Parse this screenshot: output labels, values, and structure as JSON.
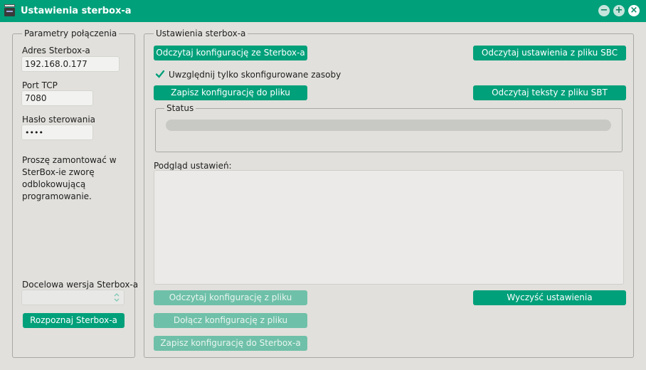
{
  "window": {
    "title": "Ustawienia sterbox-a",
    "minimize_glyph": "−",
    "maximize_glyph": "+",
    "close_glyph": "×"
  },
  "connection": {
    "group_title": "Parametry połączenia",
    "address_label": "Adres Sterbox-a",
    "address_value": "192.168.0.177",
    "port_label": "Port TCP",
    "port_value": "7080",
    "password_label": "Hasło sterowania",
    "password_value": "••••",
    "info_text": "Proszę zamontować w SterBox-ie zworę odblokowującą programowanie.",
    "target_version_label": "Docelowa wersja Sterbox-a",
    "target_version_value": "",
    "detect_button": "Rozpoznaj Sterbox-a"
  },
  "settings": {
    "group_title": "Ustawienia sterbox-a",
    "read_config_button": "Odczytaj konfigurację ze Sterbox-a",
    "read_sbc_button": "Odczytaj ustawienia z pliku SBC",
    "only_configured_label": "Uwzględnij tylko skonfigurowane zasoby",
    "only_configured_checked": true,
    "save_config_file_button": "Zapisz konfigurację do pliku",
    "read_sbt_button": "Odczytaj teksty z pliku SBT",
    "status_title": "Status",
    "status_progress": 0,
    "preview_label": "Podgląd ustawień:",
    "preview_text": "",
    "read_config_file_button": "Odczytaj konfigurację z pliku",
    "attach_config_file_button": "Dołącz konfigurację z pliku",
    "write_config_sterbox_button": "Zapisz konfigurację do Sterbox-a",
    "clear_settings_button": "Wyczyść ustawienia"
  },
  "colors": {
    "accent": "#00a07a",
    "accent_disabled": "#6fc0a8",
    "background": "#e1e0dc"
  }
}
